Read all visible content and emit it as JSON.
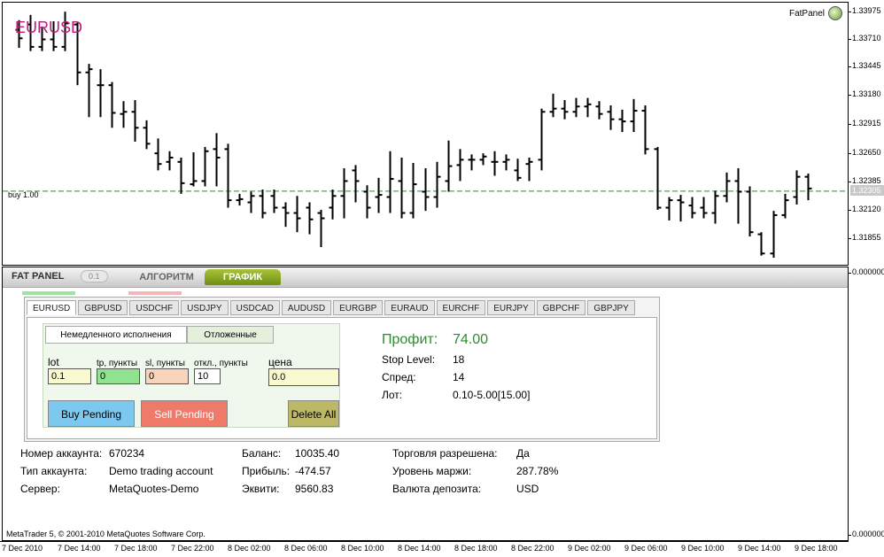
{
  "chart": {
    "symbol": "EURUSD",
    "indicator_tag": "FatPanel",
    "indicator_icon": "fatpanel-icon",
    "position_label": "buy 1.00",
    "current_price": "1.32305",
    "price_ticks": [
      "1.33975",
      "1.33710",
      "1.33445",
      "1.33180",
      "1.32915",
      "1.32650",
      "1.32385",
      "1.32120",
      "1.31855"
    ],
    "subwindow_ticks": [
      "0.000000",
      "0.000000"
    ],
    "time_ticks": [
      "7 Dec 2010",
      "7 Dec 14:00",
      "7 Dec 18:00",
      "7 Dec 22:00",
      "8 Dec 02:00",
      "8 Dec 06:00",
      "8 Dec 10:00",
      "8 Dec 14:00",
      "8 Dec 18:00",
      "8 Dec 22:00",
      "9 Dec 02:00",
      "9 Dec 06:00",
      "9 Dec 10:00",
      "9 Dec 14:00",
      "9 Dec 18:00"
    ],
    "colors": {
      "title": "#c01a7a",
      "position_line": "#2e8b2e",
      "bars": "#000000"
    },
    "bars": [
      [
        1.3382,
        1.3391,
        1.3365,
        1.3374
      ],
      [
        1.3387,
        1.3396,
        1.3362,
        1.3366
      ],
      [
        1.3366,
        1.3385,
        1.3362,
        1.3373
      ],
      [
        1.3373,
        1.339,
        1.3362,
        1.3366
      ],
      [
        1.3366,
        1.3399,
        1.3362,
        1.3388
      ],
      [
        1.3387,
        1.3389,
        1.333,
        1.3342
      ],
      [
        1.3342,
        1.335,
        1.33,
        1.3345
      ],
      [
        1.333,
        1.3345,
        1.33,
        1.333
      ],
      [
        1.333,
        1.3333,
        1.329,
        1.3304
      ],
      [
        1.3303,
        1.3315,
        1.329,
        1.3305
      ],
      [
        1.3305,
        1.3316,
        1.3277,
        1.329
      ],
      [
        1.329,
        1.3297,
        1.327,
        1.3275
      ],
      [
        1.3266,
        1.328,
        1.325,
        1.3256
      ],
      [
        1.3258,
        1.3268,
        1.325,
        1.3262
      ],
      [
        1.3258,
        1.3262,
        1.3228,
        1.3238
      ],
      [
        1.3237,
        1.3267,
        1.3235,
        1.324
      ],
      [
        1.324,
        1.3272,
        1.3235,
        1.3268
      ],
      [
        1.327,
        1.3285,
        1.3235,
        1.3262
      ],
      [
        1.327,
        1.3275,
        1.3215,
        1.3222
      ],
      [
        1.3222,
        1.3228,
        1.3217,
        1.3223
      ],
      [
        1.322,
        1.323,
        1.321,
        1.3226
      ],
      [
        1.3226,
        1.3232,
        1.3205,
        1.321
      ],
      [
        1.3226,
        1.3232,
        1.321,
        1.3215
      ],
      [
        1.3215,
        1.322,
        1.3197,
        1.321
      ],
      [
        1.321,
        1.3226,
        1.3192,
        1.3205
      ],
      [
        1.3215,
        1.322,
        1.319,
        1.3204
      ],
      [
        1.321,
        1.3213,
        1.3178,
        1.3205
      ],
      [
        1.3215,
        1.3232,
        1.3204,
        1.3226
      ],
      [
        1.3226,
        1.3252,
        1.3205,
        1.324
      ],
      [
        1.325,
        1.3255,
        1.322,
        1.324
      ],
      [
        1.323,
        1.3236,
        1.3205,
        1.3215
      ],
      [
        1.3225,
        1.3243,
        1.321,
        1.3227
      ],
      [
        1.3225,
        1.3268,
        1.321,
        1.3242
      ],
      [
        1.324,
        1.3262,
        1.3205,
        1.321
      ],
      [
        1.321,
        1.3257,
        1.3205,
        1.3237
      ],
      [
        1.323,
        1.3252,
        1.3212,
        1.3225
      ],
      [
        1.3225,
        1.3258,
        1.3215,
        1.3244
      ],
      [
        1.324,
        1.3278,
        1.323,
        1.3254
      ],
      [
        1.3255,
        1.327,
        1.324,
        1.326
      ],
      [
        1.326,
        1.3265,
        1.325,
        1.326
      ],
      [
        1.326,
        1.3266,
        1.3255,
        1.3263
      ],
      [
        1.3258,
        1.3268,
        1.3245,
        1.3258
      ],
      [
        1.3258,
        1.3265,
        1.325,
        1.326
      ],
      [
        1.325,
        1.3261,
        1.324,
        1.3243
      ],
      [
        1.3256,
        1.3262,
        1.324,
        1.3258
      ],
      [
        1.326,
        1.3308,
        1.325,
        1.3305
      ],
      [
        1.3305,
        1.3322,
        1.33,
        1.3308
      ],
      [
        1.3308,
        1.3316,
        1.3298,
        1.3305
      ],
      [
        1.3305,
        1.3318,
        1.33,
        1.331
      ],
      [
        1.331,
        1.3318,
        1.33,
        1.3312
      ],
      [
        1.331,
        1.3315,
        1.3298,
        1.3303
      ],
      [
        1.3305,
        1.3311,
        1.3288,
        1.3298
      ],
      [
        1.3298,
        1.3307,
        1.3286,
        1.3296
      ],
      [
        1.3296,
        1.3317,
        1.3286,
        1.3306
      ],
      [
        1.3306,
        1.3311,
        1.3265,
        1.327
      ],
      [
        1.327,
        1.3272,
        1.3213,
        1.3215
      ],
      [
        1.3215,
        1.3225,
        1.3203,
        1.3222
      ],
      [
        1.3222,
        1.3227,
        1.3202,
        1.322
      ],
      [
        1.3217,
        1.3225,
        1.3205,
        1.321
      ],
      [
        1.3215,
        1.3225,
        1.3205,
        1.321
      ],
      [
        1.321,
        1.3231,
        1.32,
        1.3226
      ],
      [
        1.3226,
        1.3248,
        1.322,
        1.324
      ],
      [
        1.324,
        1.3252,
        1.32,
        1.323
      ],
      [
        1.323,
        1.3235,
        1.3188,
        1.3192
      ],
      [
        1.319,
        1.3192,
        1.317,
        1.3172
      ],
      [
        1.3172,
        1.3212,
        1.3168,
        1.3208
      ],
      [
        1.3208,
        1.3228,
        1.3205,
        1.3222
      ],
      [
        1.3225,
        1.325,
        1.3218,
        1.3244
      ],
      [
        1.3244,
        1.3247,
        1.3222,
        1.3233
      ]
    ]
  },
  "panel": {
    "title": "FAT PANEL",
    "version": "0.1",
    "tabs": [
      "АЛГОРИТМ",
      "ГРАФИК"
    ],
    "symbols": [
      "EURUSD",
      "GBPUSD",
      "USDCHF",
      "USDJPY",
      "USDCAD",
      "AUDUSD",
      "EURGBP",
      "EURAUD",
      "EURCHF",
      "EURJPY",
      "GBPCHF",
      "GBPJPY"
    ],
    "order_tabs": [
      "Немедленного исполнения",
      "Отложенные"
    ],
    "fields": {
      "lot": {
        "label": "lot",
        "value": "0.1"
      },
      "tp": {
        "label": "tp, пункты",
        "value": "0"
      },
      "sl": {
        "label": "sl, пункты",
        "value": "0"
      },
      "offset": {
        "label": "откл., пункты",
        "value": "10"
      },
      "price": {
        "label": "цена",
        "value": "0.0"
      }
    },
    "buttons": {
      "buy": "Buy Pending",
      "sell": "Sell Pending",
      "delete": "Delete All"
    },
    "info": {
      "profit_label": "Профит:",
      "profit_value": "74.00",
      "stop_label": "Stop Level:",
      "stop_value": "18",
      "spread_label": "Спред:",
      "spread_value": "14",
      "lot_label": "Лот:",
      "lot_value": "0.10-5.00[15.00]"
    },
    "account": {
      "number_label": "Номер аккаунта:",
      "number_value": "670234",
      "type_label": "Тип аккаунта:",
      "type_value": "Demo trading account",
      "server_label": "Сервер:",
      "server_value": "MetaQuotes-Demo",
      "balance_label": "Баланс:",
      "balance_value": "10035.40",
      "profit_label": "Прибыль:",
      "profit_value": "-474.57",
      "equity_label": "Эквити:",
      "equity_value": "9560.83",
      "trade_label": "Торговля разрешена:",
      "trade_value": "Да",
      "margin_label": "Уровень маржи:",
      "margin_value": "287.78%",
      "currency_label": "Валюта депозита:",
      "currency_value": "USD"
    },
    "copyright": "MetaTrader 5, © 2001-2010 MetaQuotes Software Corp."
  }
}
